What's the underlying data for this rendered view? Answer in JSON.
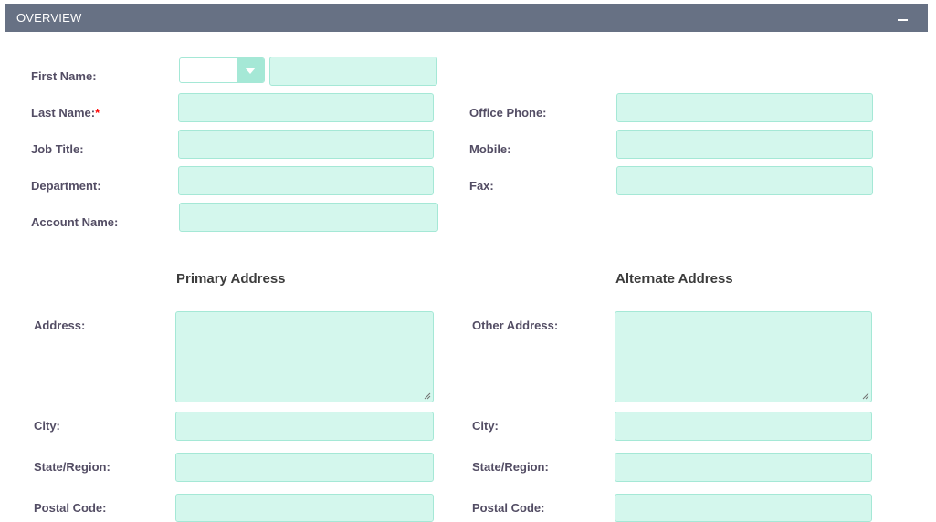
{
  "panel": {
    "title": "OVERVIEW",
    "collapse_symbol": "−"
  },
  "salutation": {
    "value": ""
  },
  "fields": {
    "first_name": {
      "label": "First Name:",
      "value": ""
    },
    "last_name": {
      "label": "Last Name:",
      "required_mark": "*",
      "value": ""
    },
    "job_title": {
      "label": "Job Title:",
      "value": ""
    },
    "department": {
      "label": "Department:",
      "value": ""
    },
    "account_name": {
      "label": "Account Name:",
      "value": ""
    },
    "office_phone": {
      "label": "Office Phone:",
      "value": ""
    },
    "mobile": {
      "label": "Mobile:",
      "value": ""
    },
    "fax": {
      "label": "Fax:",
      "value": ""
    }
  },
  "primary_address": {
    "title": "Primary Address",
    "address_label": "Address:",
    "city_label": "City:",
    "state_label": "State/Region:",
    "postal_label": "Postal Code:"
  },
  "alternate_address": {
    "title": "Alternate Address",
    "address_label": "Other Address:",
    "city_label": "City:",
    "state_label": "State/Region:",
    "postal_label": "Postal Code:"
  },
  "colors": {
    "header_bg": "#677184",
    "field_bg": "#d4f7ed",
    "field_border": "#a5e8d6",
    "label": "#534d64",
    "required": "#ff0000"
  }
}
